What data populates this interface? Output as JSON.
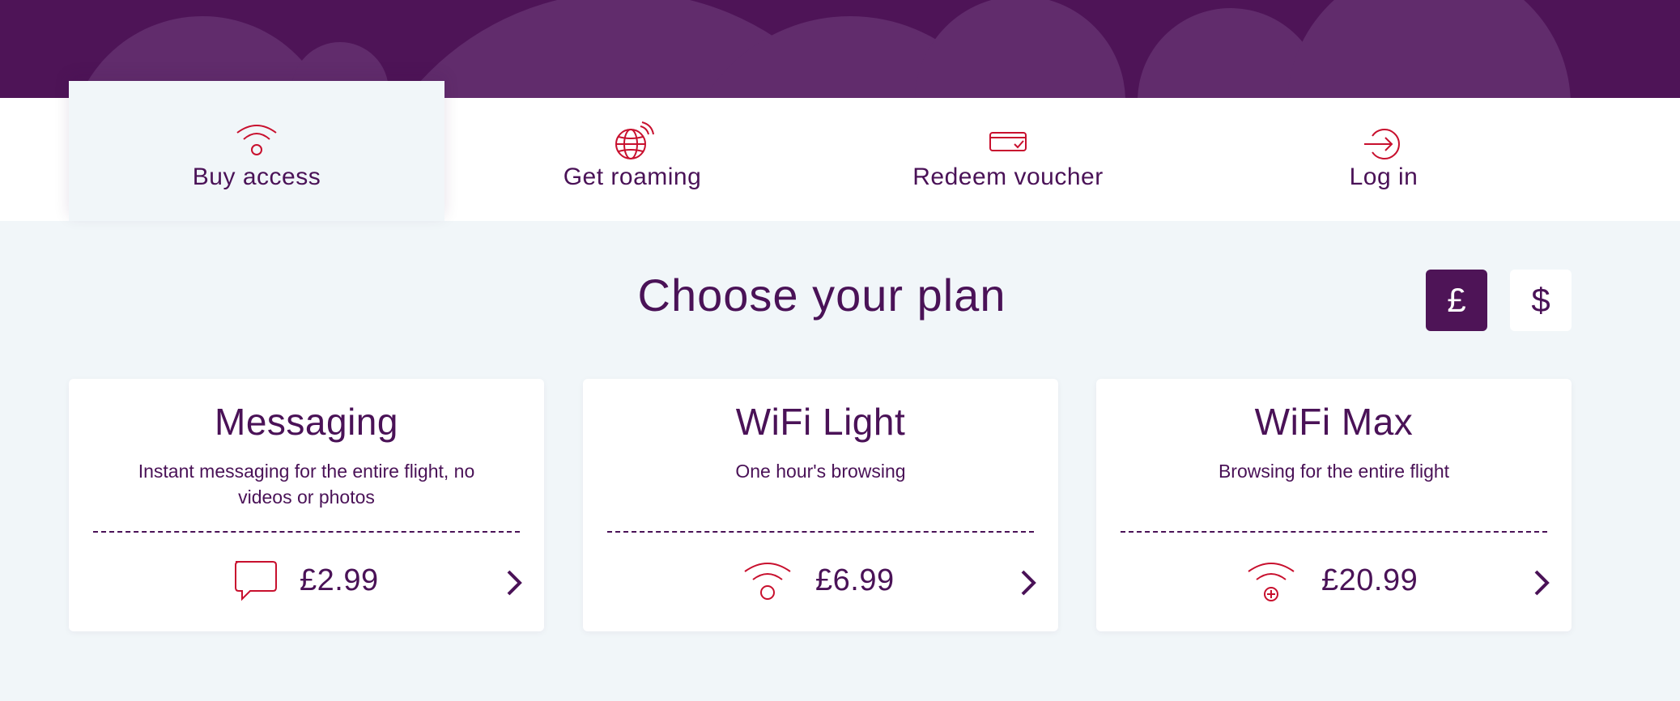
{
  "colors": {
    "brand_purple": "#4e1457",
    "accent_red": "#c8102e",
    "background": "#f1f6f9"
  },
  "nav": {
    "tabs": [
      {
        "label": "Buy access",
        "icon": "wifi-icon",
        "active": true
      },
      {
        "label": "Get roaming",
        "icon": "globe-icon",
        "active": false
      },
      {
        "label": "Redeem voucher",
        "icon": "voucher-icon",
        "active": false
      },
      {
        "label": "Log in",
        "icon": "login-icon",
        "active": false
      }
    ]
  },
  "page": {
    "title": "Choose your plan"
  },
  "currency": {
    "options": [
      {
        "symbol": "£",
        "selected": true
      },
      {
        "symbol": "$",
        "selected": false
      }
    ]
  },
  "plans": [
    {
      "name": "Messaging",
      "description": "Instant messaging for the entire flight, no videos or photos",
      "price": "£2.99",
      "icon": "chat-bubble-icon"
    },
    {
      "name": "WiFi Light",
      "description": "One hour's browsing",
      "price": "£6.99",
      "icon": "wifi-icon"
    },
    {
      "name": "WiFi Max",
      "description": "Browsing for the entire flight",
      "price": "£20.99",
      "icon": "wifi-plus-icon"
    }
  ]
}
